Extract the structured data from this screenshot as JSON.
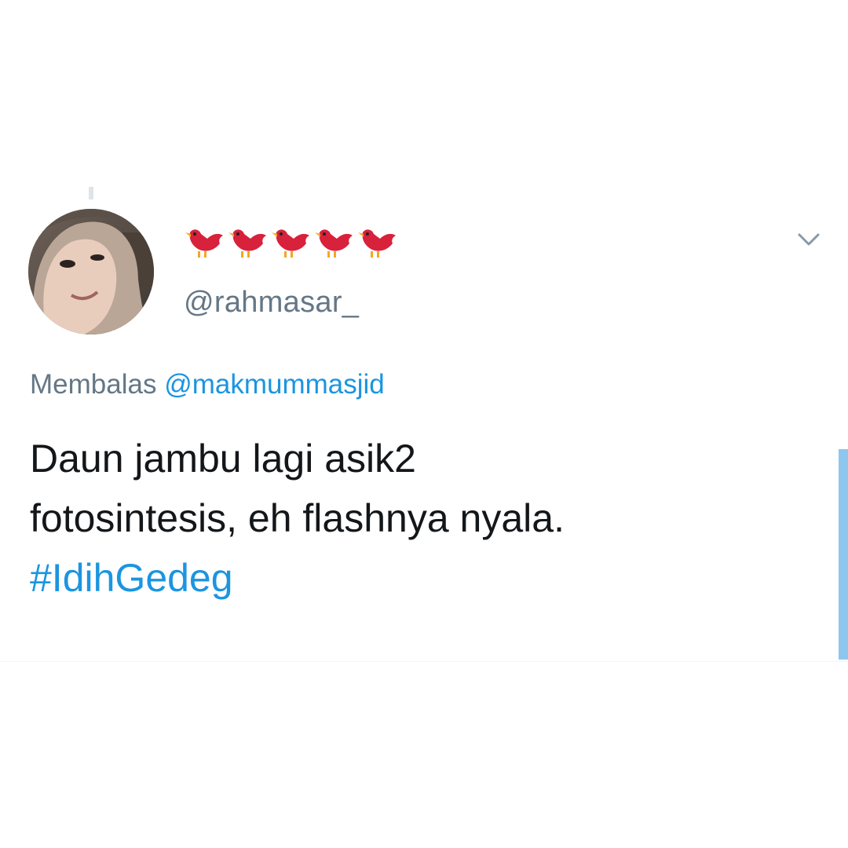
{
  "tweet": {
    "display_name_icon": "red-bird-emoji",
    "display_name_icon_count": 5,
    "handle": "@rahmasar_",
    "reply_prefix": "Membalas",
    "reply_mention": "@makmummasjid",
    "text_line1": "Daun jambu lagi asik2",
    "text_line2": "fotosintesis, eh flashnya nyala.",
    "hashtag": "#IdihGedeg"
  },
  "colors": {
    "link": "#1b95e0",
    "secondary_text": "#657786",
    "primary_text": "#14171a",
    "bird_red": "#d8213b",
    "scroll_accent": "#8dc7ee"
  }
}
